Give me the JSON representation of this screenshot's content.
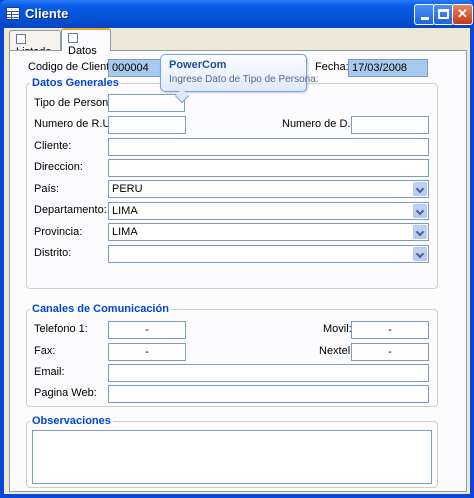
{
  "window": {
    "title": "Cliente",
    "icon": "table-icon",
    "controls": {
      "minimize": "minimize-icon",
      "maximize": "maximize-icon",
      "close": "✕"
    }
  },
  "tabs": [
    {
      "label": "Listado",
      "icon": "list-icon",
      "active": false
    },
    {
      "label": "Datos",
      "icon": "form-icon",
      "active": true
    }
  ],
  "header": {
    "codigo_label": "Codigo de Cliente:",
    "codigo_value": "000004",
    "fecha_label": "Fecha:",
    "fecha_value": "17/03/2008"
  },
  "tooltip": {
    "title": "PowerCom",
    "text": "Ingrese Dato de Tipo de Persona:"
  },
  "datos_generales": {
    "title": "Datos Generales",
    "tipo_persona_label": "Tipo de Persona:",
    "tipo_persona_value": "",
    "ruc_label": "Numero de R.U.C.:",
    "ruc_value": "",
    "dni_label": "Numero de D.N.I.:",
    "dni_value": "",
    "cliente_label": "Cliente:",
    "cliente_value": "",
    "direccion_label": "Direccion:",
    "direccion_value": "",
    "pais_label": "País:",
    "pais_value": "PERU",
    "departamento_label": "Departamento:",
    "departamento_value": "LIMA",
    "provincia_label": "Provincia:",
    "provincia_value": "LIMA",
    "distrito_label": "Distrito:",
    "distrito_value": ""
  },
  "canales": {
    "title": "Canales de Comunicación",
    "telefono_label": "Telefono 1:",
    "telefono_value": "-",
    "movil_label": "Movil:",
    "movil_value": "-",
    "fax_label": "Fax:",
    "fax_value": "-",
    "nextel_label": "Nextel:",
    "nextel_value": "-",
    "email_label": "Email:",
    "email_value": "",
    "web_label": "Pagina Web:",
    "web_value": ""
  },
  "observaciones": {
    "title": "Observaciones",
    "value": ""
  },
  "colors": {
    "titlebar": "#0552d8",
    "readonly_field": "#a6caf0",
    "group_title": "#0046d5",
    "window_bg": "#ece9d8"
  }
}
